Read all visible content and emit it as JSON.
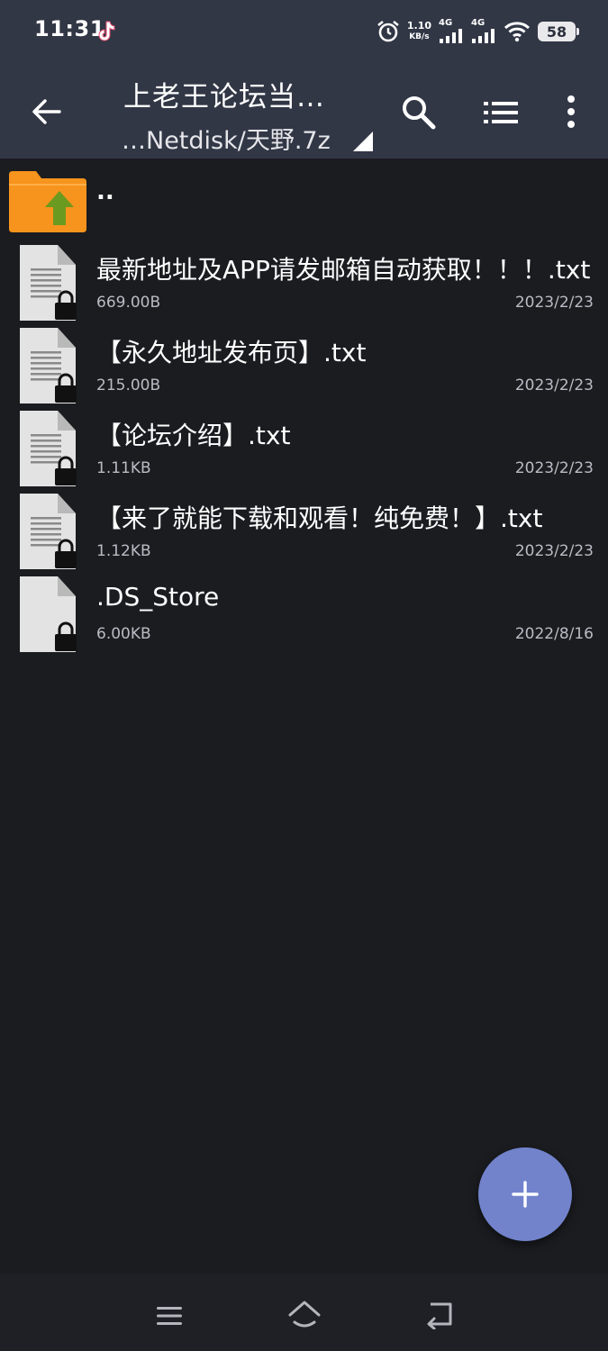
{
  "status_bar": {
    "time": "11:31",
    "speed_value": "1.10",
    "speed_unit": "KB/s",
    "network_1": "4G",
    "network_2": "4G",
    "battery": "58",
    "icons": [
      "tiktok-icon",
      "alarm-icon",
      "signal-icon",
      "signal-icon",
      "wifi-icon",
      "battery-icon"
    ]
  },
  "app_bar": {
    "title": "上老王论坛当…",
    "subtitle": "…Netdisk/天野.7z",
    "actions": [
      "back-arrow-icon",
      "search-icon",
      "list-view-icon",
      "more-vert-icon"
    ]
  },
  "parent_entry": {
    "label": ".."
  },
  "files": [
    {
      "name": "最新地址及APP请发邮箱自动获取！！！.txt",
      "size": "669.00B",
      "date": "2023/2/23"
    },
    {
      "name": "【永久地址发布页】.txt",
      "size": "215.00B",
      "date": "2023/2/23"
    },
    {
      "name": "【论坛介绍】.txt",
      "size": "1.11KB",
      "date": "2023/2/23"
    },
    {
      "name": "【来了就能下载和观看！纯免费！】.txt",
      "size": "1.12KB",
      "date": "2023/2/23"
    },
    {
      "name": ".DS_Store",
      "size": "6.00KB",
      "date": "2022/8/16"
    }
  ],
  "fab": {
    "icon": "plus-icon"
  },
  "colors": {
    "background": "#1b1c20",
    "toolbar": "#323746",
    "fab": "#7283cc",
    "folder": "#f7941d",
    "folder_arrow": "#6a9a1f"
  }
}
